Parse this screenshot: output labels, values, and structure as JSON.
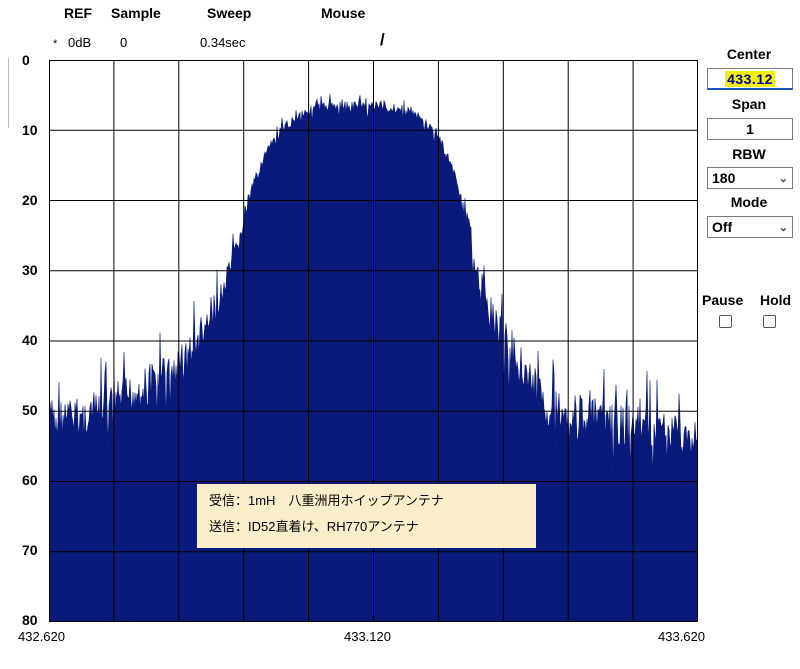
{
  "header": {
    "ref_label": "REF",
    "sample_label": "Sample",
    "sweep_label": "Sweep",
    "mouse_label": "Mouse",
    "ref_marker": "*",
    "ref_value": "0dB",
    "sample_value": "0",
    "sweep_value": "0.34sec",
    "mouse_value": "/"
  },
  "sidebar": {
    "center_label": "Center",
    "center_value": "433.12",
    "span_label": "Span",
    "span_value": "1",
    "rbw_label": "RBW",
    "rbw_value": "180",
    "mode_label": "Mode",
    "mode_value": "Off",
    "pause_label": "Pause",
    "hold_label": "Hold"
  },
  "note": {
    "line1": "受信：1mH　八重洲用ホイップアンテナ",
    "line2": "送信：ID52直着け、RH770アンテナ"
  },
  "colors": {
    "trace": "#0a1a7a",
    "grid": "#000000",
    "note_bg": "#fbeecb",
    "highlight": "#f2f200"
  },
  "chart_data": {
    "type": "area",
    "y_tick_labels": [
      "0",
      "10",
      "20",
      "30",
      "40",
      "50",
      "60",
      "70",
      "80"
    ],
    "x_tick_labels": [
      "432.620",
      "433.120",
      "433.620"
    ],
    "xlim": [
      432.62,
      433.62
    ],
    "ylim": [
      0,
      80
    ],
    "y_inverted": true,
    "grid": true,
    "series": [
      {
        "x": [
          432.62,
          432.66,
          432.7,
          432.74,
          432.78,
          432.82,
          432.85,
          432.88,
          432.91,
          432.93,
          432.95,
          432.97,
          432.99,
          433.01,
          433.03,
          433.05,
          433.07,
          433.1,
          433.13,
          433.16,
          433.18,
          433.2,
          433.22,
          433.24,
          433.26,
          433.28,
          433.3,
          433.32,
          433.34,
          433.36,
          433.38,
          433.42,
          433.46,
          433.5,
          433.54,
          433.58,
          433.62
        ],
        "y": [
          51,
          51,
          50,
          48,
          46,
          44,
          40,
          35,
          27,
          19,
          14,
          11,
          9,
          7.5,
          7,
          6.5,
          6.5,
          6.5,
          6.5,
          7,
          7.5,
          9,
          11,
          15,
          21,
          30,
          36,
          40,
          42,
          45,
          49,
          50,
          51,
          52,
          52,
          53,
          54
        ]
      }
    ]
  }
}
